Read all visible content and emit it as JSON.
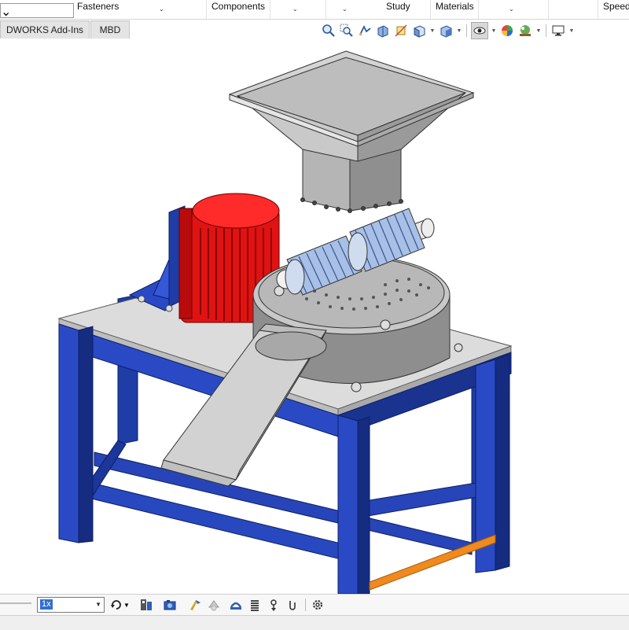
{
  "ribbon": {
    "groups": [
      {
        "label": "Fasteners"
      },
      {
        "label": "Components"
      },
      {
        "label": "Study"
      },
      {
        "label": "Materials"
      },
      {
        "label": "Speed"
      }
    ],
    "dropdown_glyph": "⌄"
  },
  "tabs": [
    {
      "label": "DWORKS Add-Ins"
    },
    {
      "label": "MBD"
    }
  ],
  "heads_up_toolbar": {
    "icons": [
      "zoom-to-fit-icon",
      "zoom-area-icon",
      "previous-view-icon",
      "section-view-icon",
      "dynamic-annotation-icon",
      "view-orientation-icon",
      "display-style-icon",
      "hide-show-items-icon",
      "edit-appearance-icon",
      "apply-scene-icon",
      "view-settings-icon"
    ]
  },
  "bottom_toolbar": {
    "zoom_value": "1x",
    "icons": [
      "rotate-icon",
      "exploded-view-icon",
      "camera-icon",
      "smart-mate-icon",
      "pin-icon",
      "belt-icon",
      "spring-icon",
      "gravity-icon",
      "contact-icon",
      "settings-icon"
    ]
  },
  "colors": {
    "frame_blue": "#1f3da6",
    "motor_red": "#e01313",
    "steel_gray": "#c8c8c8",
    "table_top": "#dcdcdc",
    "accent_orange": "#f08a1e"
  }
}
